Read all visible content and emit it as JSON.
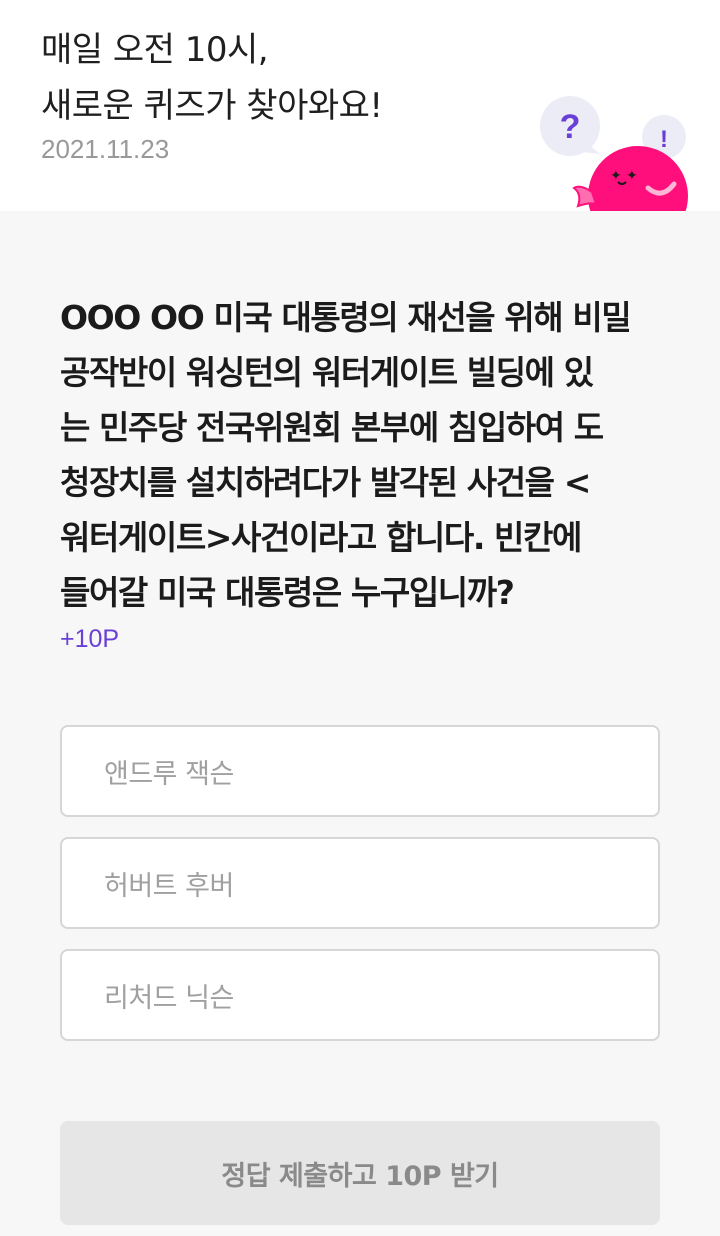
{
  "header": {
    "title_line1": "매일 오전 10시,",
    "title_line2": "새로운 퀴즈가 찾아와요!",
    "date": "2021.11.23",
    "mascot": {
      "bubble_left": "?",
      "bubble_right": "!",
      "body_color": "#ff0f7b",
      "accent_color": "#6a3fd6"
    }
  },
  "quiz": {
    "question_lines": [
      "OOO OO 미국 대통령의 재선을 위해 비밀",
      "공작반이 워싱턴의 워터게이트 빌딩에 있",
      "는 민주당 전국위원회 본부에 침입하여 도",
      "청장치를 설치하려다가 발각된 사건을 <",
      "워터게이트>사건이라고 합니다. 빈칸에",
      "들어갈 미국 대통령은 누구입니까?"
    ],
    "points": "+10P",
    "options": [
      "앤드루 잭슨",
      "허버트 후버",
      "리처드 닉슨"
    ],
    "submit_label": "정답 제출하고 10P 받기"
  },
  "colors": {
    "background": "#f7f7f7",
    "points": "#6a3fd6",
    "button_disabled_bg": "#e6e6e6",
    "button_disabled_text": "#8a8a8a"
  }
}
